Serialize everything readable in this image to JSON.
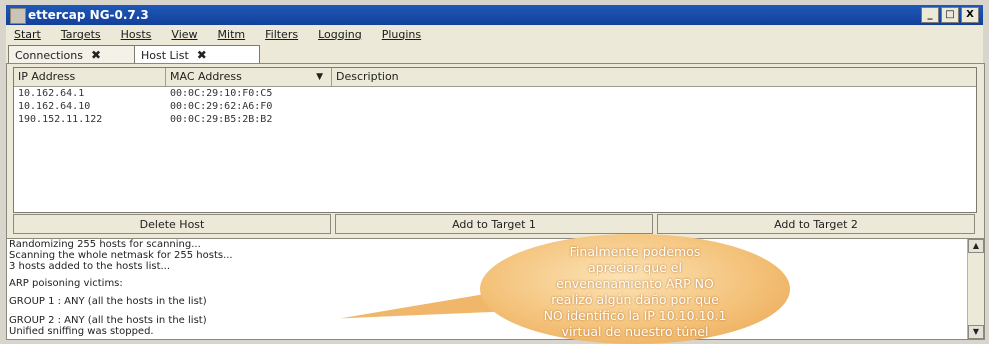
{
  "window": {
    "title": "ettercap NG-0.7.3",
    "controls": [
      "_",
      "□",
      "X"
    ]
  },
  "menu": [
    "Start",
    "Targets",
    "Hosts",
    "View",
    "Mitm",
    "Filters",
    "Logging",
    "Plugins"
  ],
  "tabs": [
    {
      "label": "Connections",
      "close": "✖"
    },
    {
      "label": "Host List",
      "close": "✖"
    }
  ],
  "hostlist": {
    "columns": [
      "IP Address",
      "MAC Address",
      "Description"
    ],
    "sort_indicator": "▼",
    "rows": [
      {
        "ip": "10.162.64.1",
        "mac": "00:0C:29:10:F0:C5"
      },
      {
        "ip": "10.162.64.10",
        "mac": "00:0C:29:62:A6:F0"
      },
      {
        "ip": "190.152.11.122",
        "mac": "00:0C:29:B5:2B:B2"
      }
    ],
    "buttons": [
      "Delete Host",
      "Add to Target 1",
      "Add to Target 2"
    ]
  },
  "log": [
    "Randomizing 255 hosts for scanning...",
    "Scanning the whole netmask for 255 hosts...",
    "3 hosts added to the hosts list...",
    "ARP poisoning victims:",
    " GROUP 1 : ANY (all the hosts in the list)",
    " GROUP 2 : ANY (all the hosts in the list)",
    "Unified sniffing was stopped."
  ],
  "annotation": {
    "lines": [
      "Finalmente podemos",
      "apreciar que el",
      "envenenamiento ARP NO",
      "realizó algún daño por que",
      "NO identificó la IP 10.10.10.1",
      "virtual de nuestro túnel"
    ]
  }
}
